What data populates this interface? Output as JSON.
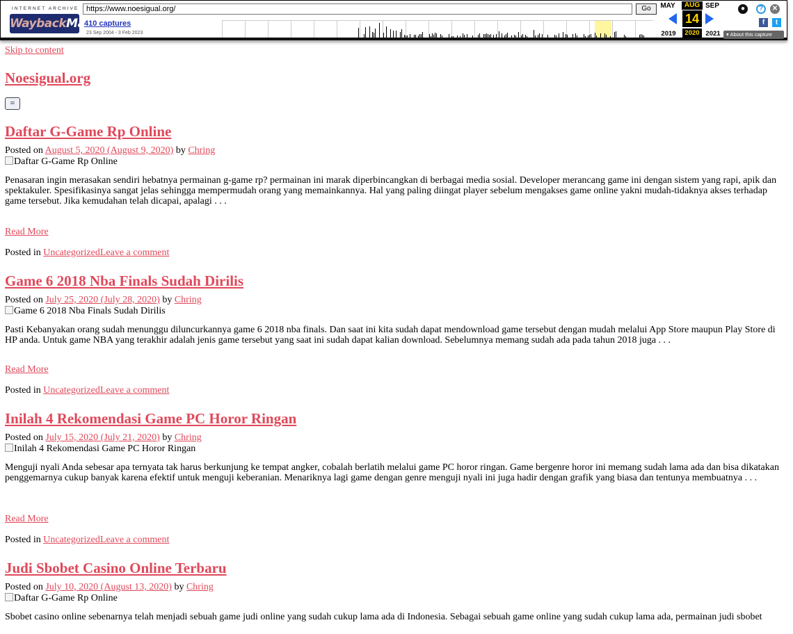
{
  "wayback": {
    "logo_top": "INTERNET ARCHIVE",
    "logo_main_a": "Wayback",
    "logo_main_b": "Machine",
    "url": "https://www.noesigual.org/",
    "go_label": "Go",
    "captures": "410 captures",
    "date_range": "23 Sep 2004 - 3 Feb 2023",
    "months": {
      "prev": "MAY",
      "cur": "AUG",
      "next": "SEP"
    },
    "day": "14",
    "years": {
      "prev": "2019",
      "cur": "2020",
      "next": "2021"
    },
    "about": "About this capture"
  },
  "site": {
    "skip": "Skip to content",
    "title": "Noesigual.org",
    "menu_icon": "≡"
  },
  "posts": [
    {
      "title": "Daftar G-Game Rp Online",
      "posted_on": "Posted on ",
      "date": "August 5, 2020 (August 9, 2020)",
      "by": " by ",
      "author": "Chring",
      "img_alt": "Daftar G-Game Rp Online",
      "excerpt": "Penasaran ingin merasakan sendiri hebatnya permainan g-game rp? permainan ini marak diperbincangkan di berbagai media sosial. Developer merancang game ini dengan sistem yang rapi, apik dan spektakuler. Spesifikasinya sangat jelas sehingga mempermudah orang yang memainkannya. Hal yang paling diingat player sebelum mengakses game online yakni mudah-tidaknya akses terhadap game tersebut. Jika kemudahan telah dicapai, apalagi . . .",
      "read_more": "Read More",
      "posted_in": "Posted in ",
      "category": "Uncategorized",
      "comment": "Leave a comment"
    },
    {
      "title": "Game 6 2018 Nba Finals Sudah Dirilis",
      "posted_on": "Posted on ",
      "date": "July 25, 2020 (July 28, 2020)",
      "by": " by ",
      "author": "Chring",
      "img_alt": "Game 6 2018 Nba Finals Sudah Dirilis",
      "excerpt": "Pasti Kebanyakan orang sudah menunggu diluncurkannya game 6 2018 nba finals. Dan saat ini kita sudah dapat mendownload game tersebut dengan mudah melalui App Store maupun Play Store di HP anda. Untuk game NBA yang terakhir adalah jenis game tersebut yang saat ini sudah dapat kalian download. Sebelumnya memang sudah ada pada tahun 2018 juga . . .",
      "read_more": "Read More",
      "posted_in": "Posted in ",
      "category": "Uncategorized",
      "comment": "Leave a comment"
    },
    {
      "title": "Inilah 4 Rekomendasi Game PC Horor Ringan",
      "posted_on": "Posted on ",
      "date": "July 15, 2020 (July 21, 2020)",
      "by": " by ",
      "author": "Chring",
      "img_alt": "Inilah 4 Rekomendasi Game PC Horor Ringan",
      "excerpt": "Menguji nyali Anda sebesar apa ternyata tak harus berkunjung ke tempat angker, cobalah berlatih melalui game PC horor ringan. Game bergenre horor ini memang sudah lama ada dan bisa dikatakan penggemarnya cukup banyak karena efektif untuk menguji keberanian.  Menariknya lagi game dengan genre menguji nyali ini juga hadir dengan grafik yang biasa dan tentunya membuatnya . . .",
      "read_more": "Read More",
      "posted_in": "Posted in ",
      "category": "Uncategorized",
      "comment": "Leave a comment"
    },
    {
      "title": "Judi Sbobet Casino Online Terbaru",
      "posted_on": "Posted on ",
      "date": "July 10, 2020 (August 13, 2020)",
      "by": " by ",
      "author": "Chring",
      "img_alt": "Daftar G-Game Rp Online",
      "excerpt": "Sbobet casino online sebenarnya telah menjadi sebuah game judi online yang sudah cukup lama ada di Indonesia. Sebagai sebuah game online yang sudah cukup lama ada, permainan judi sbobet"
    }
  ]
}
